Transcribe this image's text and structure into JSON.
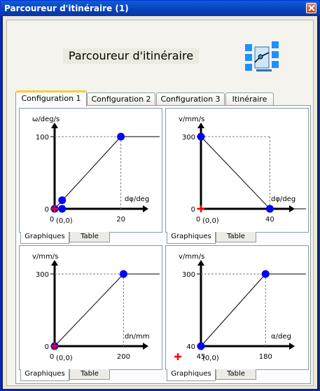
{
  "window": {
    "title": "Parcoureur d'itinéraire (1)"
  },
  "header": {
    "title": "Parcoureur d'itinéraire"
  },
  "tabs": [
    {
      "label": "Configuration 1",
      "active": true
    },
    {
      "label": "Configuration 2",
      "active": false
    },
    {
      "label": "Configuration 3",
      "active": false
    },
    {
      "label": "Itinéraire",
      "active": false
    }
  ],
  "subtabs": {
    "graph": "Graphiques",
    "table": "Table"
  },
  "colors": {
    "points": "#0000ff",
    "current": "#ff0000",
    "line": "#000000",
    "guide": "#808080"
  },
  "chart_data": [
    {
      "type": "line",
      "ylabel": "ω/deg/s",
      "xlabel": "dφ/deg",
      "xticks": [
        "0",
        "20"
      ],
      "yticks": [
        "0",
        "100"
      ],
      "origin_label": "(0,0)",
      "origin_char": "0",
      "points": [
        [
          0,
          0
        ],
        [
          20,
          100
        ]
      ],
      "extra_points": [
        [
          1,
          0
        ],
        [
          1,
          8
        ]
      ],
      "current": [
        0,
        0
      ],
      "xlim": [
        0,
        26
      ],
      "ylim": [
        0,
        100
      ]
    },
    {
      "type": "line",
      "ylabel": "v/mm/s",
      "xlabel": "dφ/deg",
      "xticks": [
        "0",
        "40"
      ],
      "yticks": [
        "0",
        "300"
      ],
      "origin_label": "(0,0)",
      "origin_char": "0",
      "points": [
        [
          0,
          300
        ],
        [
          40,
          0
        ]
      ],
      "current": [
        0,
        0
      ],
      "xlim": [
        0,
        50
      ],
      "ylim": [
        0,
        300
      ]
    },
    {
      "type": "line",
      "ylabel": "v/mm/s",
      "xlabel": "dn/mm",
      "xticks": [
        "0",
        "200"
      ],
      "yticks": [
        "0",
        "300"
      ],
      "origin_label": "(0,0)",
      "origin_char": "0",
      "points": [
        [
          0,
          0
        ],
        [
          200,
          300
        ]
      ],
      "current": [
        0,
        0
      ],
      "xlim": [
        0,
        250
      ],
      "ylim": [
        0,
        300
      ]
    },
    {
      "type": "line",
      "ylabel": "v/mm/s",
      "xlabel": "α/deg",
      "xticks": [
        "45",
        "180"
      ],
      "yticks": [
        "40",
        "300"
      ],
      "origin_label": "(0,0)",
      "origin_char": "",
      "points": [
        [
          45,
          40
        ],
        [
          180,
          300
        ]
      ],
      "current": [
        30,
        0
      ],
      "xlim": [
        45,
        225
      ],
      "ylim": [
        40,
        300
      ]
    }
  ]
}
